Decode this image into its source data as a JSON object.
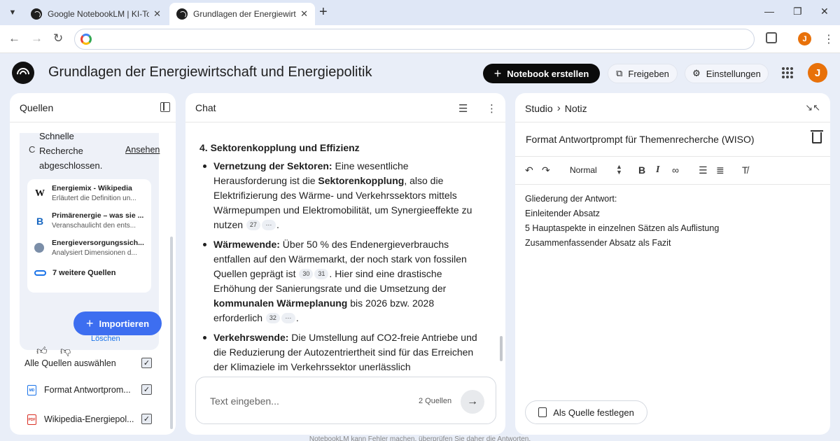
{
  "browser": {
    "tabs": [
      {
        "title": "Google NotebookLM | KI-Tool für Notizen"
      },
      {
        "title": "Grundlagen der Energiewirtschaft und Energiepolitik"
      }
    ],
    "tab_menu_icon": "chevron-down-icon",
    "new_tab": "+",
    "window_controls": [
      "—",
      "❐",
      "✕"
    ],
    "nav": {
      "back": "←",
      "forward": "→",
      "reload": "↻"
    },
    "address_value": "",
    "profile_initial": "J",
    "menu": "⋮"
  },
  "app": {
    "title": "Grundlagen der Energiewirtschaft und Energiepolitik",
    "create_notebook": "Notebook erstellen",
    "share": "Freigeben",
    "settings": "Einstellungen",
    "avatar_initial": "J",
    "accent_color": "#3d6ef0",
    "avatar_color": "#e8710a"
  },
  "sources": {
    "title": "Quellen",
    "research": {
      "text": "Schnelle Recherche abgeschlossen.",
      "link": "Ansehen"
    },
    "items": [
      {
        "icon": "wikipedia-icon",
        "glyph": "W",
        "title": "Energiemix - Wikipedia",
        "desc": "Erläutert die Definition un..."
      },
      {
        "icon": "b-logo-icon",
        "glyph": "B",
        "title": "Primärenergie – was sie ...",
        "desc": "Veranschaulicht den ents..."
      },
      {
        "icon": "globe-icon",
        "glyph": "",
        "title": "Energieversorgungssich...",
        "desc": "Analysiert Dimensionen d..."
      }
    ],
    "more_sources": "7 weitere Quellen",
    "delete": "Löschen",
    "import": "Importieren",
    "select_all": "Alle Quellen auswählen",
    "files": [
      {
        "type": "md",
        "label": "Format Antwortprom...",
        "checked": true
      },
      {
        "type": "pdf",
        "label": "Wikipedia-Energiepol...",
        "checked": true
      }
    ],
    "check_glyph": "✓"
  },
  "chat": {
    "title": "Chat",
    "section_heading": "4. Sektorenkopplung und Effizienz",
    "bullets": [
      {
        "bold": "Vernetzung der Sektoren:",
        "t1": " Eine wesentliche Herausforderung ist die ",
        "bold2": "Sektorenkopplung",
        "t2": ", also die Elektrifizierung des Wärme- und Verkehrssektors mittels Wärmepumpen und Elektromobilität, um Synergieeffekte zu nutzen",
        "cites": [
          "27",
          "···"
        ],
        "end": "."
      },
      {
        "bold": "Wärmewende:",
        "t1": " Über 50 % des Endenergieverbrauchs entfallen auf den Wärmemarkt, der noch stark von fossilen Quellen geprägt ist",
        "cites": [
          "30",
          "31"
        ],
        "t2": ". Hier sind eine drastische Erhöhung der Sanierungsrate und die Umsetzung der ",
        "bold2": "kommunalen Wärmeplanung",
        "t3": " bis 2026 bzw. 2028 erforderlich",
        "cites2": [
          "32",
          "···"
        ],
        "end": "."
      },
      {
        "bold": "Verkehrswende:",
        "t1": " Die Umstellung auf CO2-freie Antriebe und die Reduzierung der Autozentriertheit sind für das Erreichen der Klimaziele im Verkehrssektor unerlässlich"
      }
    ],
    "input_placeholder": "Text eingeben...",
    "source_count": "2 Quellen",
    "send": "→",
    "footer": "NotebookLM kann Fehler machen, überprüfen Sie daher die Antworten."
  },
  "studio": {
    "crumb_studio": "Studio",
    "crumb_sep": "›",
    "crumb_note": "Notiz",
    "note_title": "Format Antwortprompt für Themenrecherche (WISO)",
    "format": {
      "undo": "↶",
      "redo": "↷",
      "style": "Normal",
      "bold": "B",
      "italic": "I",
      "link": "∞",
      "ol": "☰",
      "ul": "≣",
      "clear": "T̸"
    },
    "note_lines": [
      "Gliederung der Antwort:",
      "Einleitender Absatz",
      "5 Hauptaspekte in einzelnen Sätzen als Auflistung",
      "Zusammenfassender Absatz als Fazit"
    ],
    "as_source": "Als Quelle festlegen"
  }
}
